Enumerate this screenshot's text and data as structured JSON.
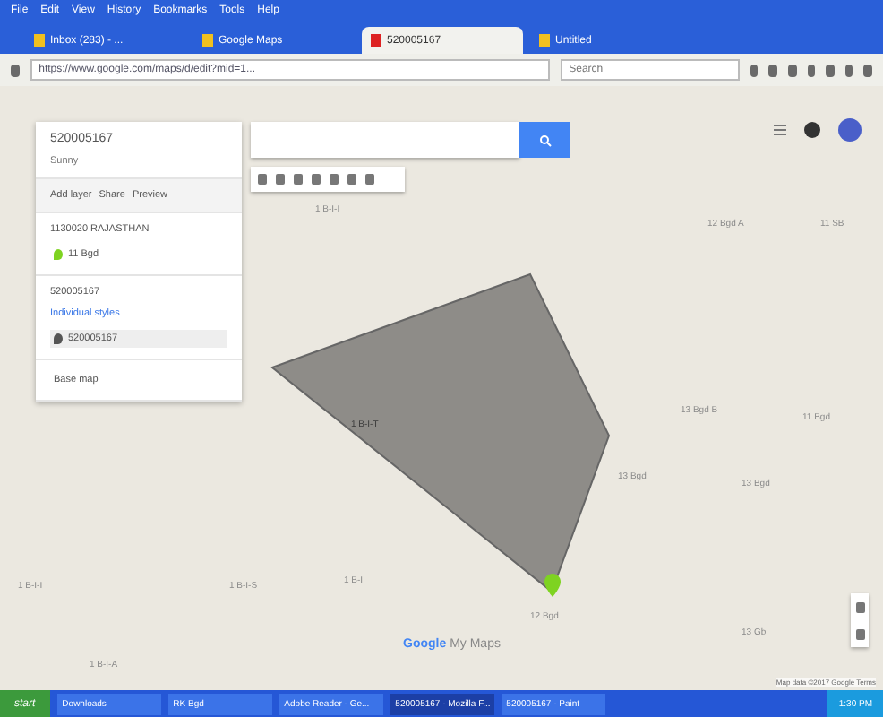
{
  "menu_bar": [
    "File",
    "Edit",
    "View",
    "History",
    "Bookmarks",
    "Tools",
    "Help"
  ],
  "tabs": [
    {
      "label": "Inbox (283) - ...",
      "selected": false
    },
    {
      "label": "Google Maps",
      "selected": false
    },
    {
      "label": "520005167",
      "selected": true
    },
    {
      "label": "Untitled",
      "selected": false
    }
  ],
  "address_bar": {
    "url": "https://www.google.com/maps/d/edit?mid=1...",
    "search_placeholder": "Search"
  },
  "map_panel": {
    "title": "520005167",
    "subtitle": "Sunny",
    "actions": [
      "Add layer",
      "Share",
      "Preview"
    ],
    "layers": [
      {
        "title": "1130020 RAJASTHAN",
        "items": [
          {
            "label": "11 Bgd",
            "color": "#7ed321"
          }
        ]
      },
      {
        "title": "520005167",
        "style": "Individual styles",
        "items": [
          {
            "label": "520005167",
            "color": "#555555"
          }
        ]
      }
    ],
    "base_map": "Base map"
  },
  "map_labels": [
    "1 B-I-I",
    "12 Bgd A",
    "11 SB",
    "1 B-I-T",
    "13 Bgd B",
    "11 Bgd",
    "13 Bgd",
    "1 B-I-I",
    "1 B-I-S",
    "1 B-I",
    "12 Bgd",
    "13 Bgd",
    "1 B-I-A",
    "13 Gb"
  ],
  "brand": {
    "logo": "Google",
    "product": "My Maps"
  },
  "attribution": "Map data ©2017 Google  Terms",
  "taskbar": {
    "start": "start",
    "windows": [
      {
        "label": "Downloads",
        "selected": false
      },
      {
        "label": "RK Bgd",
        "selected": false
      },
      {
        "label": "Adobe Reader - Ge...",
        "selected": false
      },
      {
        "label": "520005167 - Mozilla F...",
        "selected": true
      },
      {
        "label": "520005167 - Paint",
        "selected": false
      }
    ],
    "clock": "1:30 PM"
  }
}
